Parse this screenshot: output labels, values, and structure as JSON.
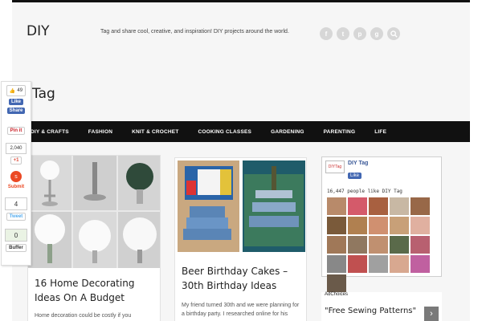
{
  "site": {
    "title": "DIY",
    "tagline": "Tag and share cool, creative, and inspiration! DIY projects around the world."
  },
  "social_icons": [
    "facebook-icon",
    "twitter-icon",
    "pinterest-icon",
    "google-plus-icon",
    "search-icon"
  ],
  "page_title": "Tag",
  "nav": {
    "items": [
      {
        "label": "DIY & CRAFTS"
      },
      {
        "label": "FASHION"
      },
      {
        "label": "KNIT & CROCHET"
      },
      {
        "label": "COOKING CLASSES"
      },
      {
        "label": "GARDENING"
      },
      {
        "label": "PARENTING"
      },
      {
        "label": "LIFE"
      }
    ]
  },
  "posts": [
    {
      "title": "16 Home Decorating Ideas On A Budget",
      "excerpt": "Home decoration could be costly if you"
    },
    {
      "title": "Beer Birthday Cakes – 30th Birthday Ideas",
      "excerpt": "My friend turned 30th and we were planning for a birthday party. I researched online for his"
    }
  ],
  "facebook_widget": {
    "logo_text": "DIYTag",
    "page_name": "DIY Tag",
    "like_label": "Like",
    "people_count": "16,447 people like DIY Tag"
  },
  "ad": {
    "choices_label": "AdChoices",
    "text": "\"Free Sewing Patterns\"",
    "arrow": "›"
  },
  "sharebar": {
    "like_count": "49",
    "fb_like": "Like",
    "fb_share": "Share",
    "pin_label": "Pin it",
    "gplus_count": "2,040",
    "gplus_label": "+1",
    "su_label": "Submit",
    "tweet_count": "4",
    "tweet_label": "Tweet",
    "buffer_count": "0",
    "buffer_label": "Buffer"
  },
  "colors": {
    "nav_bg": "#111111",
    "page_bg": "#f6f6f6",
    "facebook": "#3b5998",
    "twitter": "#55acee",
    "stumbleupon": "#eb4924",
    "gplus": "#dd4b39",
    "pinterest": "#cb2027"
  }
}
